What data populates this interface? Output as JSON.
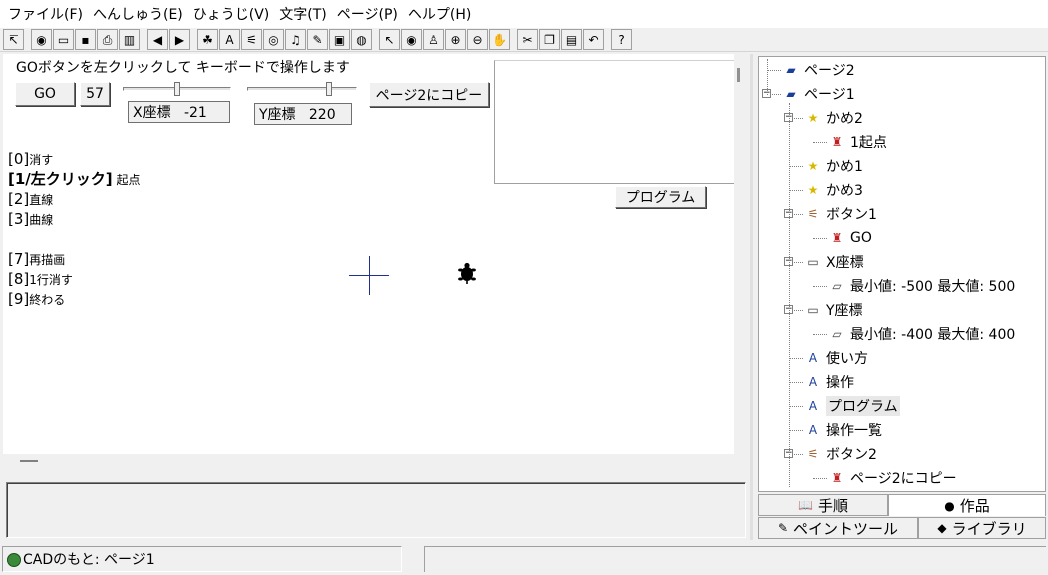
{
  "menu": [
    "ファイル(F)",
    "へんしゅう(E)",
    "ひょうじ(V)",
    "文字(T)",
    "ページ(P)",
    "ヘルプ(H)"
  ],
  "toolbar": {
    "buttons": [
      {
        "name": "pointer-small-icon",
        "glyph": "↸"
      },
      {
        "name": "globe-icon",
        "glyph": "◉"
      },
      {
        "name": "open-folder-icon",
        "glyph": "▭"
      },
      {
        "name": "save-icon",
        "glyph": "▪"
      },
      {
        "name": "print-icon",
        "glyph": "⎙"
      },
      {
        "name": "layout-icon",
        "glyph": "▥"
      },
      {
        "name": "back-arrow-icon",
        "glyph": "◀"
      },
      {
        "name": "forward-arrow-icon",
        "glyph": "▶"
      },
      {
        "name": "turtle-icon",
        "glyph": "☘"
      },
      {
        "name": "text-a-icon",
        "glyph": "A"
      },
      {
        "name": "button-tool-icon",
        "glyph": "⚟"
      },
      {
        "name": "eye-icon",
        "glyph": "◎"
      },
      {
        "name": "music-note-icon",
        "glyph": "♫"
      },
      {
        "name": "pen-icon",
        "glyph": "✎"
      },
      {
        "name": "camera-icon",
        "glyph": "▣"
      },
      {
        "name": "map-icon",
        "glyph": "◍"
      },
      {
        "name": "cursor-arrow-icon",
        "glyph": "↖"
      },
      {
        "name": "view-icon",
        "glyph": "◉"
      },
      {
        "name": "person-icon",
        "glyph": "♙"
      },
      {
        "name": "zoom-in-icon",
        "glyph": "⊕"
      },
      {
        "name": "zoom-out-icon",
        "glyph": "⊖"
      },
      {
        "name": "stop-hand-icon",
        "glyph": "✋"
      },
      {
        "name": "cut-icon",
        "glyph": "✂"
      },
      {
        "name": "copy-icon",
        "glyph": "❐"
      },
      {
        "name": "paste-icon",
        "glyph": "▤"
      },
      {
        "name": "undo-icon",
        "glyph": "↶"
      },
      {
        "name": "help-icon",
        "glyph": "?"
      }
    ]
  },
  "canvas": {
    "hint": "GOボタンを左クリックして キーボードで操作します",
    "go_label": "GO",
    "count_value": "57",
    "x_coord_label": "X座標   -21",
    "y_coord_label": "Y座標   220",
    "x_slider_level": 0.5,
    "y_slider_level": 0.75,
    "copy_button_label": "ページ2にコピー",
    "program_button_label": "プログラム",
    "commands": [
      {
        "key": "[0]",
        "text": "消す",
        "bold": false
      },
      {
        "key": "[1/左クリック]",
        "text": " 起点",
        "bold": true
      },
      {
        "key": "[2]",
        "text": "直線",
        "bold": false
      },
      {
        "key": "[3]",
        "text": "曲線",
        "bold": false
      },
      {
        "key": "",
        "text": "",
        "bold": false
      },
      {
        "key": "[7]",
        "text": "再描画",
        "bold": false
      },
      {
        "key": "[8]",
        "text": "1行消す",
        "bold": false
      },
      {
        "key": "[9]",
        "text": "終わる",
        "bold": false
      }
    ]
  },
  "status": {
    "text": "CADのもと: ページ1"
  },
  "tree": {
    "items": [
      {
        "label": "ページ2",
        "icon": "page-icon",
        "glyph": "▰",
        "color": "#1a3f9a",
        "level": 0,
        "expander": ""
      },
      {
        "label": "ページ1",
        "icon": "page-icon",
        "glyph": "▰",
        "color": "#1a3f9a",
        "level": 0,
        "expander": "−"
      },
      {
        "label": "かめ2",
        "icon": "turtle-star-icon",
        "glyph": "★",
        "color": "#d8b800",
        "level": 1,
        "expander": "−"
      },
      {
        "label": "1起点",
        "icon": "rocket-icon",
        "glyph": "♜",
        "color": "#c02020",
        "level": 2,
        "expander": ""
      },
      {
        "label": "かめ1",
        "icon": "turtle-star-icon",
        "glyph": "★",
        "color": "#d8b800",
        "level": 1,
        "expander": ""
      },
      {
        "label": "かめ3",
        "icon": "turtle-star-icon",
        "glyph": "★",
        "color": "#d8b800",
        "level": 1,
        "expander": ""
      },
      {
        "label": "ボタン1",
        "icon": "button-hand-icon",
        "glyph": "⚟",
        "color": "#a06030",
        "level": 1,
        "expander": "−"
      },
      {
        "label": "GO",
        "icon": "rocket-icon",
        "glyph": "♜",
        "color": "#c02020",
        "level": 2,
        "expander": ""
      },
      {
        "label": "X座標",
        "icon": "slider-icon",
        "glyph": "▭",
        "color": "#404040",
        "level": 1,
        "expander": "−"
      },
      {
        "label": "最小値: -500  最大値: 500",
        "icon": "range-icon",
        "glyph": "▱",
        "color": "#404040",
        "level": 2,
        "expander": ""
      },
      {
        "label": "Y座標",
        "icon": "slider-icon",
        "glyph": "▭",
        "color": "#404040",
        "level": 1,
        "expander": "−"
      },
      {
        "label": "最小値: -400  最大値: 400",
        "icon": "range-icon",
        "glyph": "▱",
        "color": "#404040",
        "level": 2,
        "expander": ""
      },
      {
        "label": "使い方",
        "icon": "text-a-icon",
        "glyph": "A",
        "color": "#1a3f9a",
        "level": 1,
        "expander": ""
      },
      {
        "label": "操作",
        "icon": "text-a-icon",
        "glyph": "A",
        "color": "#1a3f9a",
        "level": 1,
        "expander": ""
      },
      {
        "label": "プログラム",
        "icon": "text-a-icon",
        "glyph": "A",
        "color": "#1a3f9a",
        "level": 1,
        "expander": "",
        "selected": true
      },
      {
        "label": "操作一覧",
        "icon": "text-a-icon",
        "glyph": "A",
        "color": "#1a3f9a",
        "level": 1,
        "expander": ""
      },
      {
        "label": "ボタン2",
        "icon": "button-hand-icon",
        "glyph": "⚟",
        "color": "#a06030",
        "level": 1,
        "expander": "−"
      },
      {
        "label": "ページ2にコピー",
        "icon": "rocket-icon",
        "glyph": "♜",
        "color": "#c02020",
        "level": 2,
        "expander": ""
      }
    ]
  },
  "tabs": {
    "top": [
      {
        "label": "手順",
        "icon": "book-icon",
        "glyph": "📖"
      },
      {
        "label": "作品",
        "icon": "globe-icon",
        "glyph": "●"
      }
    ],
    "bottom": [
      {
        "label": "ペイントツール",
        "icon": "brush-icon",
        "glyph": "✎"
      },
      {
        "label": "ライブラリ",
        "icon": "shapes-icon",
        "glyph": "◆"
      }
    ]
  }
}
